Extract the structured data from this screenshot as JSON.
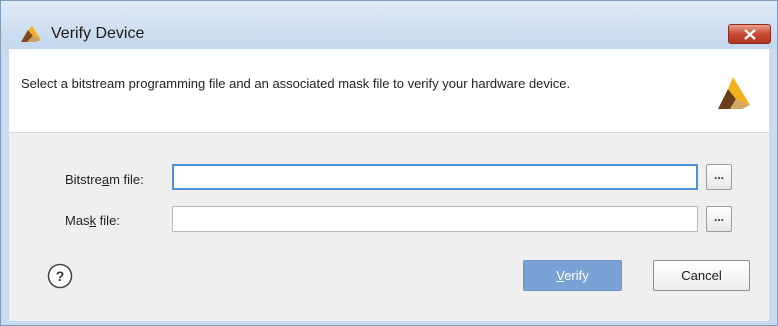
{
  "window": {
    "title": "Verify Device",
    "icon": "xilinx-logo-icon",
    "close_icon": "close-icon",
    "accent_color": "#c84a34"
  },
  "header": {
    "description": "Select a bitstream programming file and an associated mask file to verify your hardware device.",
    "logo_icon": "xilinx-logo-icon"
  },
  "form": {
    "bitstream": {
      "label_pre": "Bitstre",
      "label_mnemonic": "a",
      "label_post": "m file:",
      "value": "",
      "browse_label": "..."
    },
    "mask": {
      "label_pre": "Mas",
      "label_mnemonic": "k",
      "label_post": " file:",
      "value": "",
      "browse_label": "..."
    }
  },
  "footer": {
    "help_icon": "help-icon",
    "verify_mnemonic": "V",
    "verify_rest": "erify",
    "cancel_label": "Cancel",
    "verify_color": "#7aa2d6"
  }
}
